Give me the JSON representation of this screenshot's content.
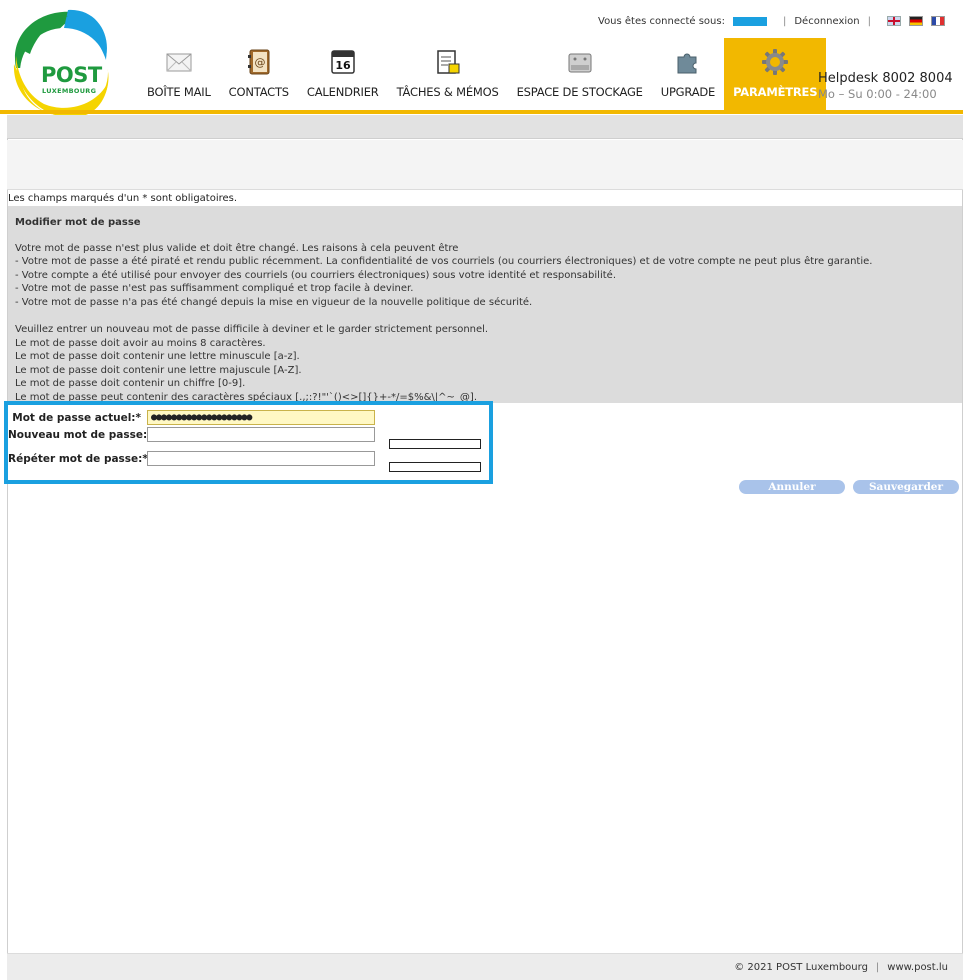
{
  "brand": {
    "name": "POST",
    "subtitle": "LUXEMBOURG",
    "colors": {
      "green": "#1f9a3f",
      "yellow": "#f2b800",
      "blue": "#1aa0e0"
    }
  },
  "topbar": {
    "connected_label": "Vous êtes connecté sous:",
    "logout_label": "Déconnexion",
    "languages": [
      "uk-flag-icon",
      "de-flag-icon",
      "fr-flag-icon"
    ]
  },
  "nav": {
    "items": [
      {
        "label": "BOÎTE MAIL",
        "icon": "mail-icon"
      },
      {
        "label": "CONTACTS",
        "icon": "address-book-icon"
      },
      {
        "label": "CALENDRIER",
        "icon": "calendar-icon",
        "day": "16"
      },
      {
        "label": "TÂCHES & MÉMOS",
        "icon": "tasks-icon"
      },
      {
        "label": "ESPACE DE STOCKAGE",
        "icon": "storage-icon"
      },
      {
        "label": "UPGRADE",
        "icon": "puzzle-icon"
      },
      {
        "label": "PARAMÈTRES",
        "icon": "gear-icon",
        "active": true
      }
    ]
  },
  "helpdesk": {
    "title": "Helpdesk 8002 8004",
    "hours": "Mo – Su 0:00 - 24:00"
  },
  "main": {
    "required_note": "Les champs marqués d'un * sont obligatoires.",
    "panel_title": "Modifier mot de passe",
    "reasons_intro": "Votre mot de passe n'est plus valide et doit être changé. Les raisons à cela peuvent être",
    "reasons": [
      "- Votre mot de passe a été piraté et rendu public récemment. La confidentialité de vos courriels (ou courriers électroniques) et de votre compte ne peut plus être garantie.",
      "- Votre compte a été utilisé pour envoyer des courriels (ou courriers électroniques) sous votre identité et responsabilité.",
      "- Votre mot de passe n'est pas suffisamment compliqué et trop facile à deviner.",
      "- Votre mot de passe n'a pas été changé depuis la mise en vigueur de la nouvelle politique de sécurité."
    ],
    "rules_intro": "Veuillez entrer un nouveau mot de passe difficile à deviner et le garder strictement personnel.",
    "rules": [
      "Le mot de passe doit avoir au moins 8 caractères.",
      "Le mot de passe doit contenir une lettre minuscule [a-z].",
      "Le mot de passe doit contenir une lettre majuscule [A-Z].",
      "Le mot de passe doit contenir un chiffre [0-9].",
      "Le mot de passe peut contenir des caractères spéciaux [.,;:?!\"'`()<>[]{}+-*/=$%&\\|^~_@]."
    ]
  },
  "form": {
    "current_label": "Mot de passe actuel:*",
    "current_value": "●●●●●●●●●●●●●●●●●●●●",
    "new_label": "Nouveau mot de passe:*",
    "new_value": "",
    "repeat_label": "Répéter mot de passe:*",
    "repeat_value": ""
  },
  "actions": {
    "cancel_label": "Annuler",
    "save_label": "Sauvegarder"
  },
  "footer": {
    "copyright": "© 2021 POST Luxembourg",
    "site": "www.post.lu"
  }
}
